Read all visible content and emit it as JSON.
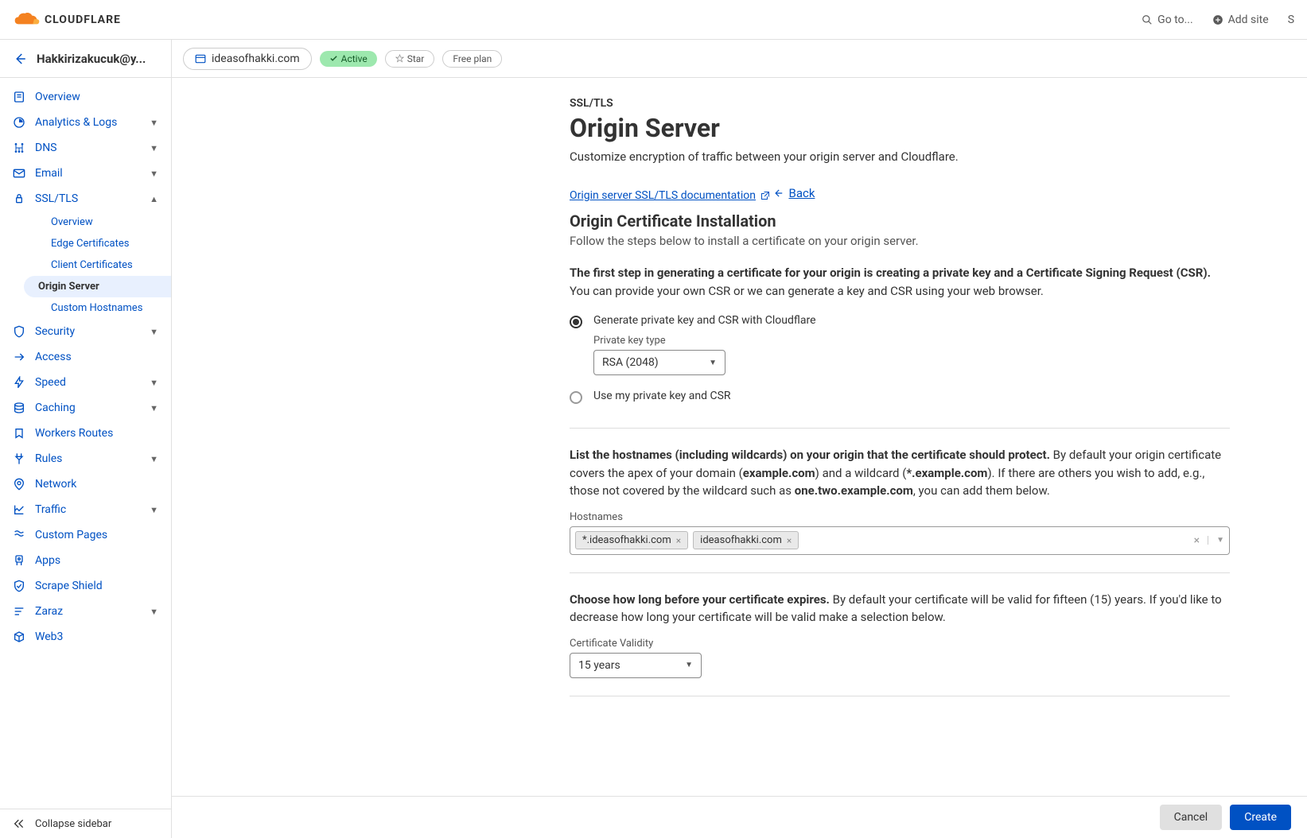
{
  "brand": "CLOUDFLARE",
  "topbar": {
    "goto": "Go to...",
    "addsite": "Add site"
  },
  "account": {
    "email": "Hakkirizakucuk@y..."
  },
  "sidebar": {
    "items": [
      {
        "label": "Overview",
        "expandable": false
      },
      {
        "label": "Analytics & Logs",
        "expandable": true
      },
      {
        "label": "DNS",
        "expandable": true
      },
      {
        "label": "Email",
        "expandable": true
      },
      {
        "label": "SSL/TLS",
        "expandable": true,
        "expanded": true,
        "sub": [
          {
            "label": "Overview"
          },
          {
            "label": "Edge Certificates"
          },
          {
            "label": "Client Certificates"
          },
          {
            "label": "Origin Server",
            "active": true
          },
          {
            "label": "Custom Hostnames"
          }
        ]
      },
      {
        "label": "Security",
        "expandable": true
      },
      {
        "label": "Access",
        "expandable": false
      },
      {
        "label": "Speed",
        "expandable": true
      },
      {
        "label": "Caching",
        "expandable": true
      },
      {
        "label": "Workers Routes",
        "expandable": false
      },
      {
        "label": "Rules",
        "expandable": true
      },
      {
        "label": "Network",
        "expandable": false
      },
      {
        "label": "Traffic",
        "expandable": true
      },
      {
        "label": "Custom Pages",
        "expandable": false
      },
      {
        "label": "Apps",
        "expandable": false
      },
      {
        "label": "Scrape Shield",
        "expandable": false
      },
      {
        "label": "Zaraz",
        "expandable": true
      },
      {
        "label": "Web3",
        "expandable": false
      }
    ],
    "collapse": "Collapse sidebar"
  },
  "domain": {
    "name": "ideasofhakki.com",
    "status": "Active",
    "star": "Star",
    "plan": "Free plan"
  },
  "page": {
    "breadcrumb": "SSL/TLS",
    "title": "Origin Server",
    "desc": "Customize encryption of traffic between your origin server and Cloudflare.",
    "doclink": "Origin server SSL/TLS documentation",
    "back": "Back",
    "section_title": "Origin Certificate Installation",
    "section_desc": "Follow the steps below to install a certificate on your origin server.",
    "step1_bold": "The first step in generating a certificate for your origin is creating a private key and a Certificate Signing Request (CSR).",
    "step1_rest": " You can provide your own CSR or we can generate a key and CSR using your web browser.",
    "radio1": "Generate private key and CSR with Cloudflare",
    "pk_label": "Private key type",
    "pk_value": "RSA (2048)",
    "radio2": "Use my private key and CSR",
    "hostnames_intro_bold": "List the hostnames (including wildcards) on your origin that the certificate should protect.",
    "hostnames_intro_1": " By default your origin certificate covers the apex of your domain (",
    "hostnames_intro_b1": "example.com",
    "hostnames_intro_2": ") and a wildcard (",
    "hostnames_intro_b2": "*.example.com",
    "hostnames_intro_3": "). If there are others you wish to add, e.g., those not covered by the wildcard such as ",
    "hostnames_intro_b3": "one.two.example.com",
    "hostnames_intro_4": ", you can add them below.",
    "hostnames_label": "Hostnames",
    "hostnames": [
      "*.ideasofhakki.com",
      "ideasofhakki.com"
    ],
    "validity_intro_bold": "Choose how long before your certificate expires.",
    "validity_intro_rest": " By default your certificate will be valid for fifteen (15) years. If you'd like to decrease how long your certificate will be valid make a selection below.",
    "validity_label": "Certificate Validity",
    "validity_value": "15 years",
    "cancel": "Cancel",
    "create": "Create"
  }
}
